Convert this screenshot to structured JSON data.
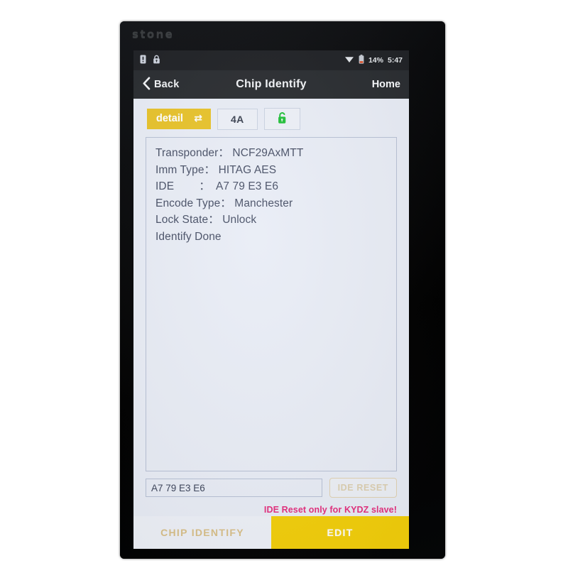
{
  "device": {
    "brand_logo": "stone"
  },
  "statusbar": {
    "icons_left": [
      "sim-card-icon",
      "lock-icon"
    ],
    "wifi_icon": "wifi-icon",
    "battery_icon": "battery-low-icon",
    "battery_percent": "14%",
    "clock": "5:47"
  },
  "titlebar": {
    "back_label": "Back",
    "back_icon": "chevron-left-icon",
    "title": "Chip Identify",
    "home_label": "Home"
  },
  "toolbar": {
    "detail_label": "detail",
    "detail_icon": "swap-arrows-icon",
    "page_label": "4A",
    "lock_icon": "unlocked-padlock-icon"
  },
  "log": {
    "lines": [
      "Transponder： NCF29AxMTT",
      "Imm Type： HITAG AES",
      "IDE        ：  A7 79 E3 E6",
      "Encode Type： Manchester",
      "Lock State： Unlock",
      "Identify Done"
    ]
  },
  "entry": {
    "ide_value": "A7 79 E3 E6",
    "ide_placeholder": "A7 79 E3 E6",
    "reset_label": "IDE RESET",
    "warning": "IDE Reset only for KYDZ slave!"
  },
  "tabs": [
    {
      "label": "CHIP IDENTIFY",
      "active": false
    },
    {
      "label": "EDIT",
      "active": true
    }
  ],
  "colors": {
    "accent_yellow": "#f3cf0b",
    "detail_yellow": "#e8c32c",
    "warning_pink": "#e5307f",
    "unlock_green": "#22c03a",
    "app_bg": "#e9edf6",
    "titlebar_bg": "#2a2d31",
    "statusbar_bg": "#202226"
  }
}
